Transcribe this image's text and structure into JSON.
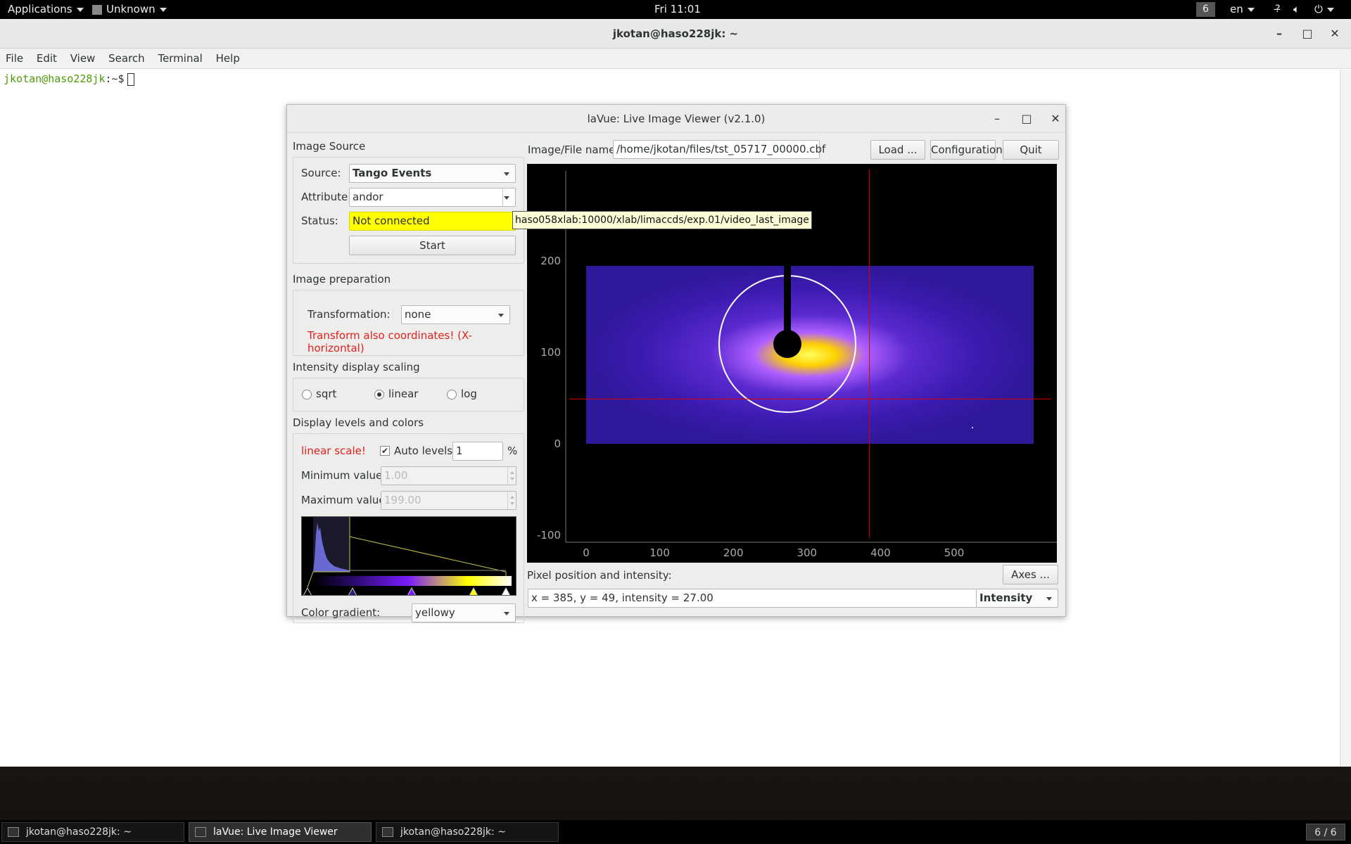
{
  "topbar": {
    "applications": "Applications",
    "app_menu": "Unknown",
    "clock": "Fri 11:01",
    "workspace": "6",
    "language": "en"
  },
  "terminal": {
    "title": "jkotan@haso228jk: ~",
    "menu": [
      "File",
      "Edit",
      "View",
      "Search",
      "Terminal",
      "Help"
    ],
    "prompt_user": "jkotan@haso228jk",
    "prompt_rest": ":~$"
  },
  "lavue": {
    "title": "laVue: Live Image Viewer (v2.1.0)",
    "image_source": {
      "heading": "Image Source",
      "source_label": "Source:",
      "source_value": "Tango Events",
      "attribute_label": "Attribute:",
      "attribute_value": "andor",
      "status_label": "Status:",
      "status_value": "Not connected",
      "start_label": "Start",
      "tooltip": "haso058xlab:10000/xlab/limaccds/exp.01/video_last_image"
    },
    "image_prep": {
      "heading": "Image preparation",
      "transformation_label": "Transformation:",
      "transformation_value": "none",
      "warning": "Transform also coordinates! (X-horizontal)"
    },
    "scaling": {
      "heading": "Intensity display scaling",
      "options": [
        "sqrt",
        "linear",
        "log"
      ],
      "selected": "linear"
    },
    "levels": {
      "heading": "Display levels and colors",
      "scale_note": "linear scale!",
      "auto_levels_label": "Auto levels",
      "auto_levels_checked": true,
      "auto_value": "1",
      "percent": "%",
      "min_label": "Minimum value:",
      "min_value": "1.00",
      "max_label": "Maximum value:",
      "max_value": "199.00",
      "gradient_label": "Color gradient:",
      "gradient_value": "yellowy"
    },
    "file": {
      "label": "Image/File name:",
      "path": "/home/jkotan/files/tst_05717_00000.cbf",
      "load": "Load ...",
      "configuration": "Configuration",
      "quit": "Quit"
    },
    "pixel": {
      "label": "Pixel position and intensity:",
      "axes": "Axes ...",
      "readout": "x = 385, y = 49, intensity = 27.00",
      "mode": "Intensity"
    },
    "plot": {
      "x_ticks": [
        "0",
        "100",
        "200",
        "300",
        "400",
        "500"
      ],
      "y_ticks": [
        "200",
        "100",
        "0",
        "-100"
      ],
      "crosshair_x": 385,
      "crosshair_y": 49
    }
  },
  "taskbar": {
    "tasks": [
      "jkotan@haso228jk: ~",
      "laVue: Live Image Viewer (v2.1.0)",
      "jkotan@haso228jk: ~"
    ],
    "pager": "6 / 6"
  }
}
